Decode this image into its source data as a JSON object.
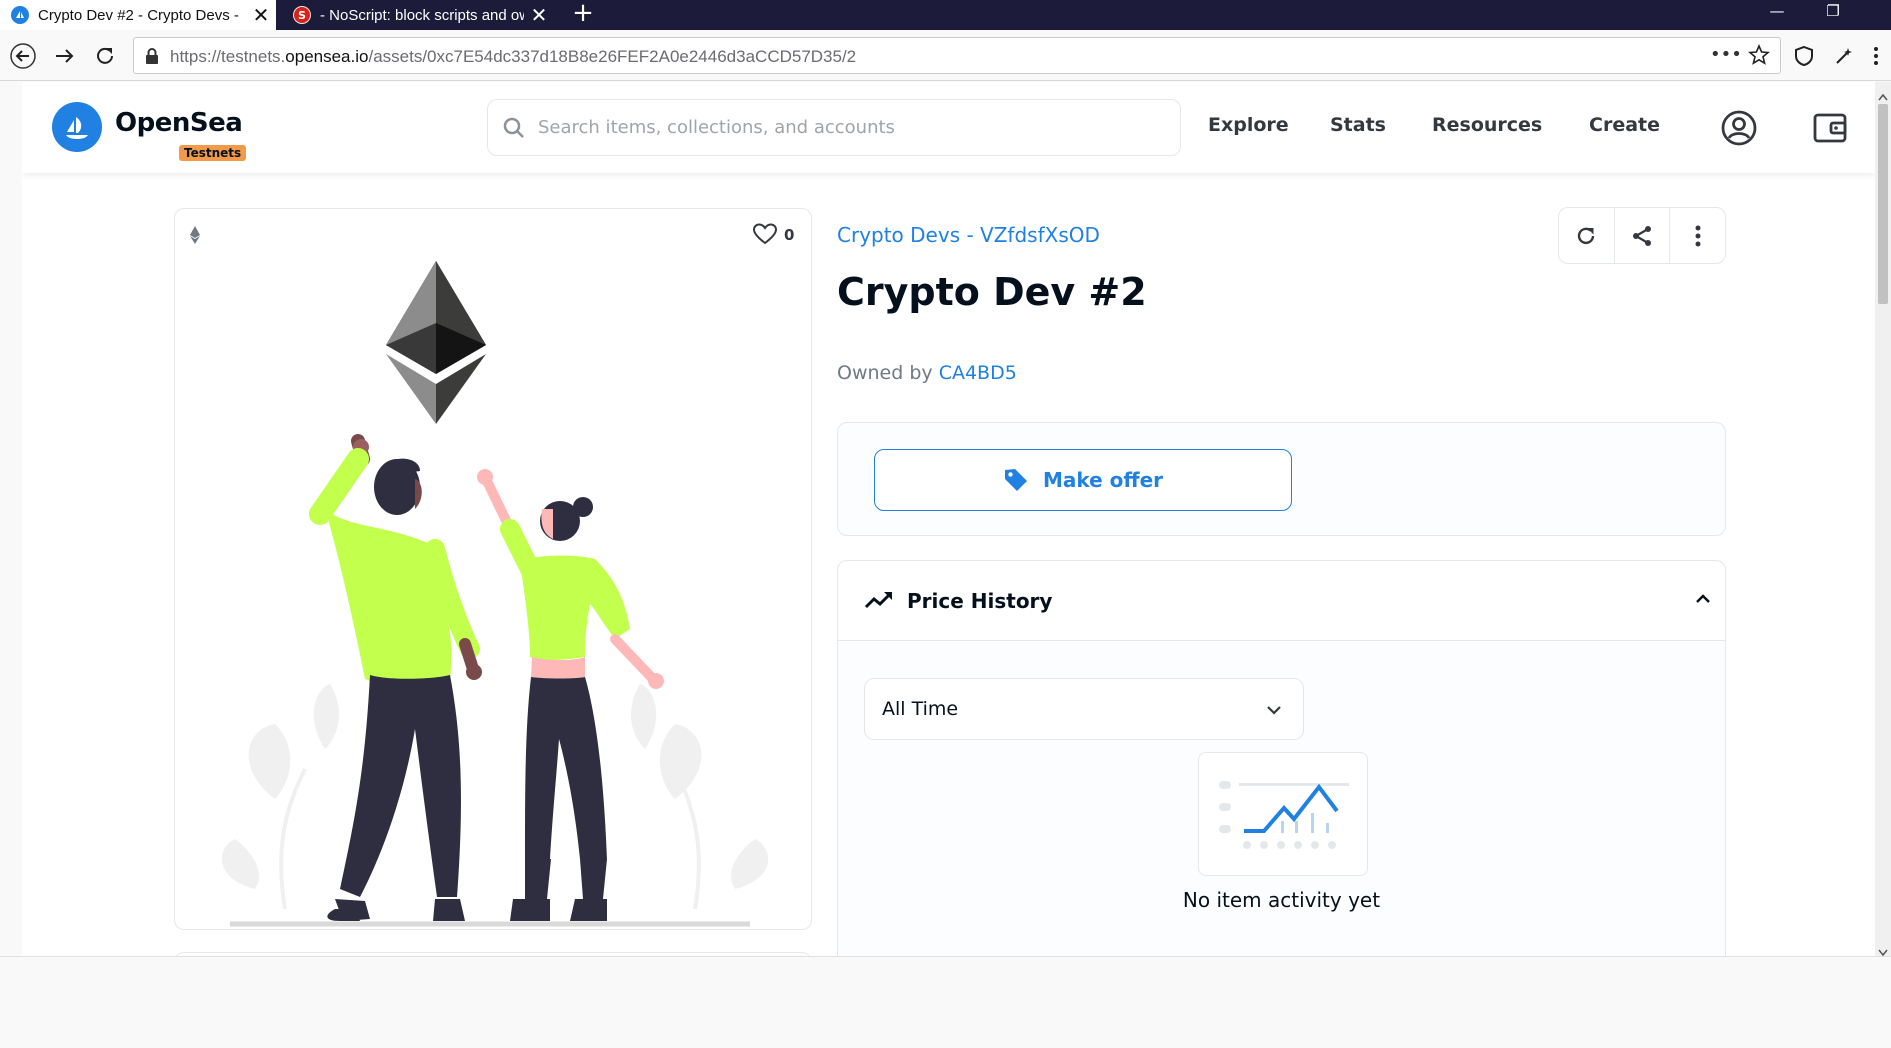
{
  "browser": {
    "tabs": [
      {
        "title": "Crypto Dev #2 - Crypto Devs - ",
        "active": true
      },
      {
        "title": " - NoScript: block scripts and ow",
        "active": false
      }
    ],
    "new_tab_symbol": "+",
    "window_controls": {
      "minimize": "—",
      "restore": "❐"
    },
    "url": {
      "prefix": "https://testnets.",
      "domain": "opensea.io",
      "path": "/assets/0xc7E54dc337d18B8e26FEF2A0e2446d3aCCD57D35/2"
    }
  },
  "site": {
    "brand": "OpenSea",
    "badge": "Testnets",
    "search_placeholder": "Search items, collections, and accounts",
    "nav": [
      "Explore",
      "Stats",
      "Resources",
      "Create"
    ]
  },
  "asset": {
    "chain_icon": "ethereum-icon",
    "favorites_count": "0",
    "collection": "Crypto Devs - VZfdsfXsOD",
    "title": "Crypto Dev #2",
    "owned_by_label": "Owned by",
    "owner": "CA4BD5",
    "make_offer_label": "Make offer",
    "price_history": {
      "title": "Price History",
      "period": "All Time",
      "empty_text": "No item activity yet"
    }
  },
  "colors": {
    "accent": "#2081e2",
    "badge": "#f2994a",
    "tab_bar": "#1c1b3a",
    "illustration_green": "#c3ff4d"
  }
}
